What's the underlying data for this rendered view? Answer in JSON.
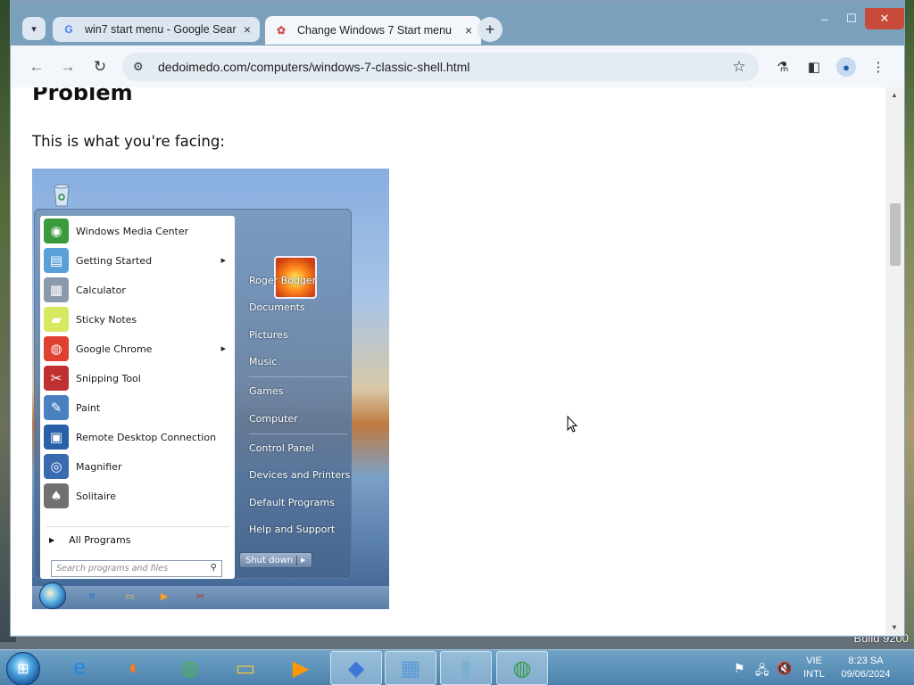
{
  "desktop": {
    "build_text": "Build 9200"
  },
  "browser": {
    "tabs": [
      {
        "title": "win7 start menu - Google Sear",
        "favicon": "G",
        "close": "×",
        "active": false
      },
      {
        "title": "Change Windows 7 Start menu",
        "favicon": "✿",
        "close": "×",
        "active": true
      }
    ],
    "new_tab": "+",
    "dropdown": "▾",
    "window_controls": {
      "minimize": "–",
      "maximize": "☐",
      "close": "✕"
    },
    "nav": {
      "back": "←",
      "forward": "→",
      "reload": "↻"
    },
    "address": "dedoimedo.com/computers/windows-7-classic-shell.html",
    "site_info_icon": "⚙",
    "toolbar_icons": {
      "star": "☆",
      "labs": "⚗",
      "sidepanel": "◧",
      "profile": "●",
      "menu": "⋮"
    }
  },
  "page": {
    "heading": "Problem",
    "paragraph": "This is what you're facing:"
  },
  "start_menu": {
    "programs": [
      {
        "label": "Windows Media Center",
        "icon": "media-center-icon",
        "glyph": "◉",
        "color": "#3b9a3b",
        "submenu": false
      },
      {
        "label": "Getting Started",
        "icon": "getting-started-icon",
        "glyph": "▤",
        "color": "#5aa0d8",
        "submenu": true
      },
      {
        "label": "Calculator",
        "icon": "calculator-icon",
        "glyph": "▦",
        "color": "#8a9aaa",
        "submenu": false
      },
      {
        "label": "Sticky Notes",
        "icon": "sticky-notes-icon",
        "glyph": "▰",
        "color": "#d8e860",
        "submenu": false
      },
      {
        "label": "Google Chrome",
        "icon": "chrome-icon",
        "glyph": "◍",
        "color": "#e04030",
        "submenu": true
      },
      {
        "label": "Snipping Tool",
        "icon": "snipping-tool-icon",
        "glyph": "✂",
        "color": "#c03030",
        "submenu": false
      },
      {
        "label": "Paint",
        "icon": "paint-icon",
        "glyph": "✎",
        "color": "#4a80c0",
        "submenu": false
      },
      {
        "label": "Remote Desktop Connection",
        "icon": "remote-desktop-icon",
        "glyph": "▣",
        "color": "#2a60a8",
        "submenu": false
      },
      {
        "label": "Magnifier",
        "icon": "magnifier-icon",
        "glyph": "◎",
        "color": "#3a6ab0",
        "submenu": false
      },
      {
        "label": "Solitaire",
        "icon": "solitaire-icon",
        "glyph": "♠",
        "color": "#707070",
        "submenu": false
      }
    ],
    "all_programs": "All Programs",
    "search_placeholder": "Search programs and files",
    "right_items": {
      "user": "Roger Bodger",
      "documents": "Documents",
      "pictures": "Pictures",
      "music": "Music",
      "games": "Games",
      "computer": "Computer",
      "control_panel": "Control Panel",
      "devices": "Devices and Printers",
      "default_programs": "Default Programs",
      "help": "Help and Support"
    },
    "shutdown": "Shut down"
  },
  "taskbar": {
    "apps": [
      {
        "name": "ie",
        "glyph": "e",
        "color": "#1e88e5",
        "active": false
      },
      {
        "name": "firefox",
        "glyph": "◐",
        "color": "#ff7a1a",
        "active": false
      },
      {
        "name": "chrome-old",
        "glyph": "◍",
        "color": "#4caf50",
        "active": false
      },
      {
        "name": "explorer",
        "glyph": "▭",
        "color": "#f0c040",
        "active": false
      },
      {
        "name": "media-player",
        "glyph": "▶",
        "color": "#ff9800",
        "active": false
      },
      {
        "name": "drop",
        "glyph": "◆",
        "color": "#3c78d8",
        "active": true
      },
      {
        "name": "control-panel",
        "glyph": "▦",
        "color": "#5a9ad8",
        "active": true
      },
      {
        "name": "device",
        "glyph": "▮",
        "color": "#7ab0d0",
        "active": true
      },
      {
        "name": "chrome",
        "glyph": "◍",
        "color": "#3a9a4a",
        "active": true
      }
    ],
    "tray": {
      "flag": "⚑",
      "network": "🖧",
      "volume": "🔇"
    },
    "lang_line1": "VIE",
    "lang_line2": "INTL",
    "time": "8:23 SA",
    "date": "09/06/2024"
  }
}
